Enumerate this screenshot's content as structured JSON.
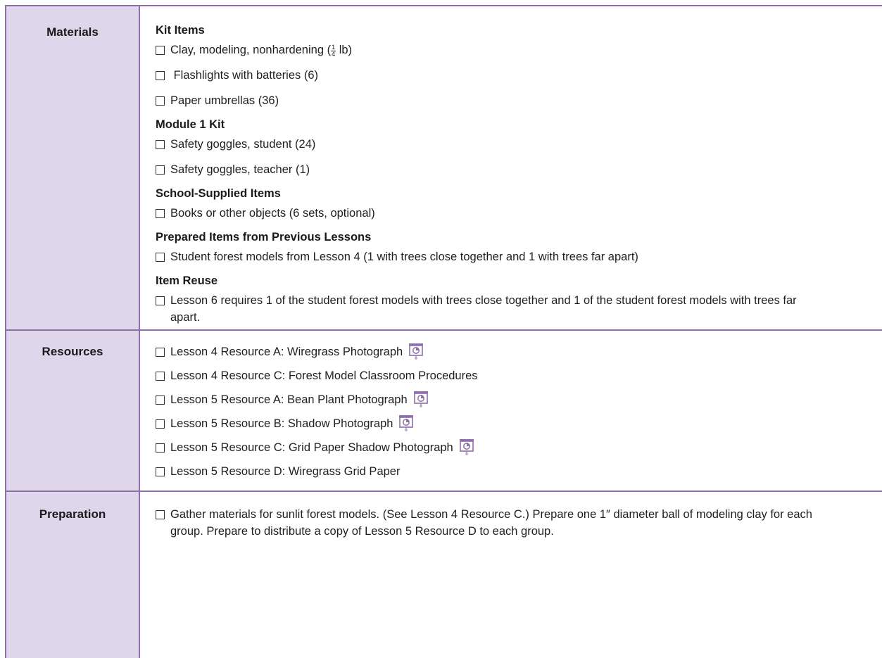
{
  "materials": {
    "label": "Materials",
    "groups": [
      {
        "heading": "Kit Items",
        "items": [
          {
            "before": "Clay, modeling, nonhardening (",
            "frac_num": "1",
            "frac_den": "4",
            "after": " lb)"
          },
          {
            "text": " Flashlights with batteries (6)"
          },
          {
            "text": "Paper umbrellas (36)"
          }
        ]
      },
      {
        "heading": "Module 1 Kit",
        "items": [
          {
            "text": "Safety goggles, student (24)"
          },
          {
            "text": "Safety goggles, teacher (1)"
          }
        ]
      },
      {
        "heading": "School-Supplied Items",
        "items": [
          {
            "text": "Books or other objects (6 sets, optional)"
          }
        ]
      },
      {
        "heading": "Prepared Items from Previous Lessons",
        "items": [
          {
            "text": "Student forest models from Lesson 4 (1 with trees close together and 1 with trees far apart)"
          }
        ]
      },
      {
        "heading": "Item Reuse",
        "items": [
          {
            "text": "Lesson 6 requires 1 of the student forest models with trees close together and 1 of the student forest models with trees far apart."
          }
        ]
      }
    ]
  },
  "resources": {
    "label": "Resources",
    "items": [
      {
        "text": "Lesson 4 Resource A: Wiregrass Photograph",
        "icon": "projector-icon"
      },
      {
        "text": "Lesson 4 Resource C: Forest Model Classroom Procedures"
      },
      {
        "text": "Lesson 5 Resource A: Bean Plant Photograph",
        "icon": "projector-icon"
      },
      {
        "text": "Lesson 5 Resource B: Shadow Photograph",
        "icon": "projector-icon"
      },
      {
        "text": "Lesson 5 Resource C: Grid Paper Shadow Photograph",
        "icon": "projector-icon"
      },
      {
        "text": "Lesson 5 Resource D: Wiregrass Grid Paper"
      }
    ]
  },
  "preparation": {
    "label": "Preparation",
    "items": [
      {
        "text": "Gather materials for sunlit forest models. (See Lesson 4 Resource C.) Prepare one 1″ diameter ball of modeling clay for each group. Prepare to distribute a copy of Lesson 5 Resource D to each group."
      }
    ]
  },
  "colors": {
    "border": "#8e6fa8",
    "header_fill": "#ded6ea",
    "icon_accent": "#8e6fa8"
  }
}
